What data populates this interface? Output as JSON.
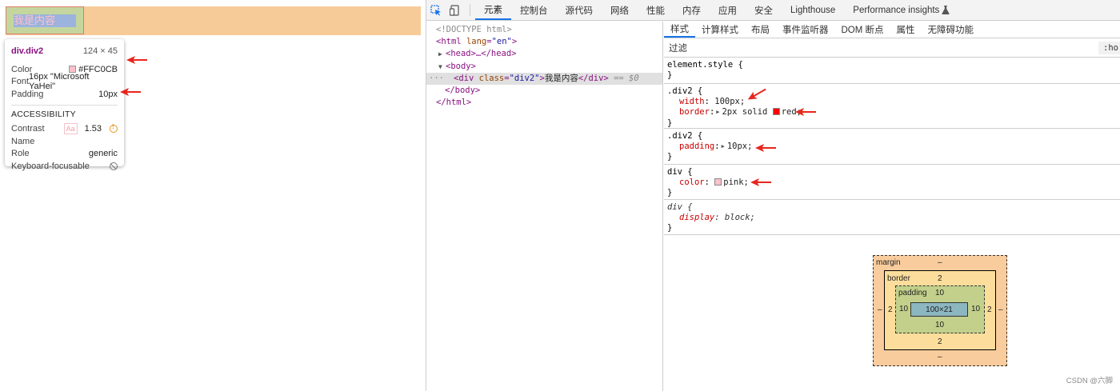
{
  "viewport": {
    "div_text": "我是内容",
    "tooltip": {
      "selector": "div.div2",
      "size": "124 × 45",
      "rows": [
        {
          "key": "Color",
          "value": "#FFC0CB"
        },
        {
          "key": "Font",
          "value": "16px \"Microsoft YaHei\""
        },
        {
          "key": "Padding",
          "value": "10px"
        }
      ],
      "accessibility_title": "ACCESSIBILITY",
      "a11y": {
        "contrast_key": "Contrast",
        "contrast_badge": "Aa",
        "contrast_value": "1.53",
        "name_key": "Name",
        "role_key": "Role",
        "role_value": "generic",
        "focus_key": "Keyboard-focusable"
      }
    }
  },
  "toolbar": {
    "tabs": [
      "元素",
      "控制台",
      "源代码",
      "网络",
      "性能",
      "内存",
      "应用",
      "安全",
      "Lighthouse",
      "Performance insights"
    ],
    "active_tab": "元素"
  },
  "dom": {
    "doctype": "<!DOCTYPE html>",
    "html_open_tag": "html",
    "html_attr": "lang",
    "html_attr_val": "\"en\"",
    "head": "<head>…</head>",
    "body_open": "<body>",
    "div_open_tag": "<div",
    "div_attr": "class",
    "div_attr_val": "\"div2\"",
    "div_text": "我是内容",
    "div_close": "</div>",
    "selected_marker": "== $0",
    "body_close": "</body>",
    "html_close": "</html>",
    "ellipsis": "···"
  },
  "styles": {
    "subtabs": [
      "样式",
      "计算样式",
      "布局",
      "事件监听器",
      "DOM 断点",
      "属性",
      "无障碍功能"
    ],
    "active_subtab": "样式",
    "filter_placeholder": "过滤",
    "hov_label": ":ho",
    "rules": [
      {
        "selector": "element.style {",
        "props": []
      },
      {
        "selector": ".div2 {",
        "props": [
          {
            "name": "width",
            "value": "100px;"
          },
          {
            "name": "border",
            "value": "2px solid",
            "color_value": "red;",
            "swatch": "#ff0000"
          }
        ]
      },
      {
        "selector": ".div2 {",
        "props": [
          {
            "name": "padding",
            "value": "10px;"
          }
        ]
      },
      {
        "selector": "div {",
        "props": [
          {
            "name": "color",
            "value": "pink;",
            "swatch": "#ffc0cb"
          }
        ]
      },
      {
        "selector": "div {",
        "props": [
          {
            "name": "display",
            "value": "block;"
          }
        ]
      }
    ],
    "close_brace": "}",
    "ua_selector": "div {",
    "ua_prop": "display: block;"
  },
  "boxmodel": {
    "margin_label": "margin",
    "margin_top": "–",
    "margin_bottom": "–",
    "margin_left": "–",
    "margin_right": "–",
    "border_label": "border",
    "border_top": "2",
    "border_bottom": "2",
    "border_left": "2",
    "border_right": "2",
    "padding_label": "padding",
    "padding_top": "10",
    "padding_bottom": "10",
    "padding_left": "10",
    "padding_right": "10",
    "content": "100×21"
  },
  "watermark": "CSDN @六脚"
}
